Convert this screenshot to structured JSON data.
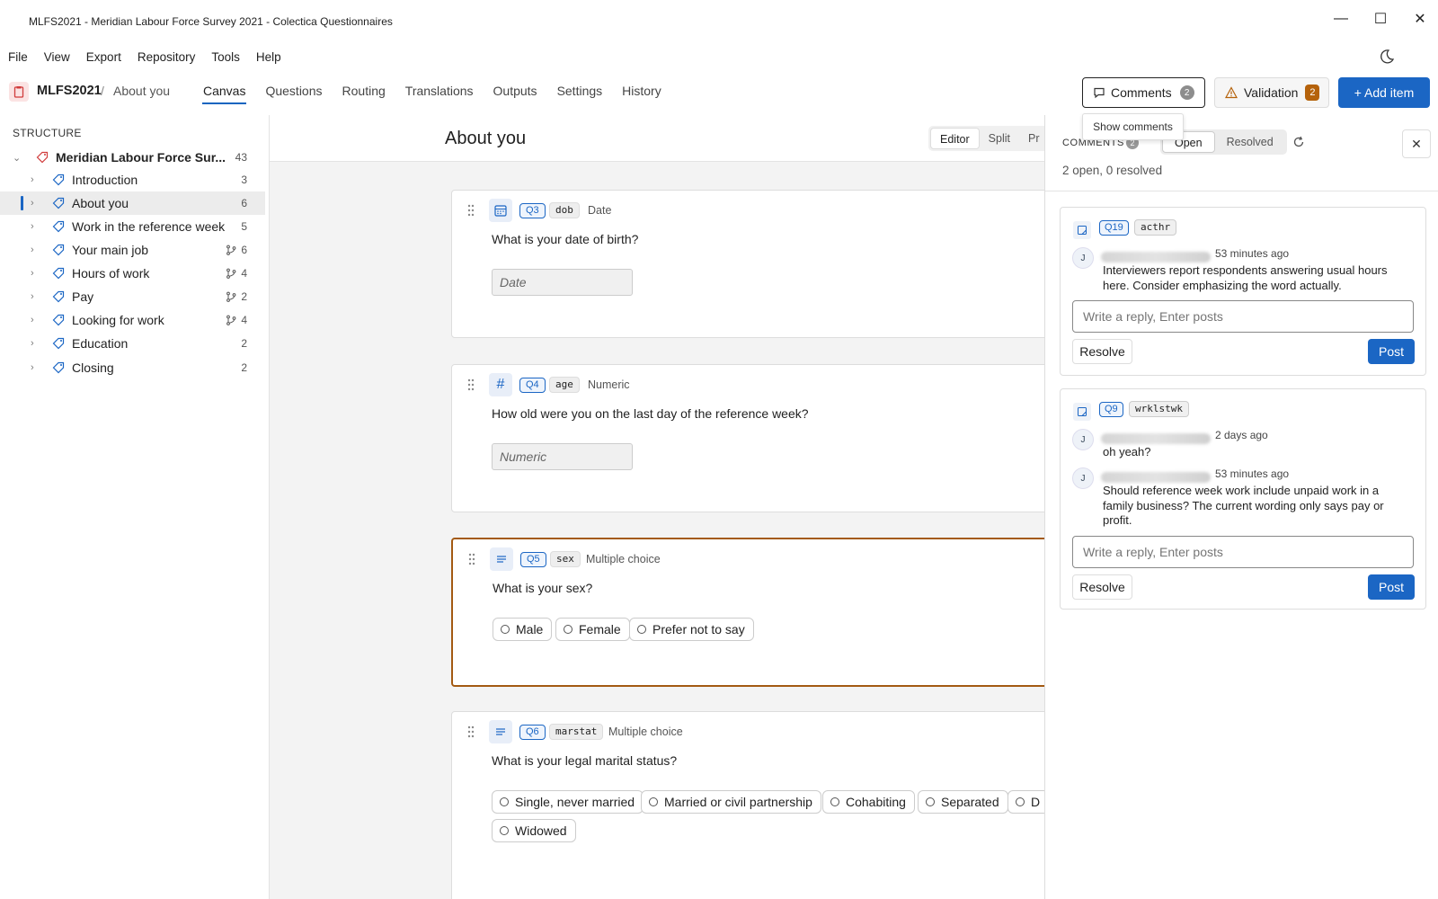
{
  "window": {
    "title": "MLFS2021 - Meridian Labour Force Survey 2021 - Colectica Questionnaires",
    "minimize": "—",
    "maximize": "☐",
    "close": "✕"
  },
  "menu": [
    "File",
    "View",
    "Export",
    "Repository",
    "Tools",
    "Help"
  ],
  "breadcrumb": {
    "root": "MLFS2021",
    "sep": "/",
    "current": "About you"
  },
  "tabs": [
    {
      "label": "Canvas",
      "active": true
    },
    {
      "label": "Questions"
    },
    {
      "label": "Routing"
    },
    {
      "label": "Translations"
    },
    {
      "label": "Outputs"
    },
    {
      "label": "Settings"
    },
    {
      "label": "History"
    }
  ],
  "toolbar": {
    "comments_label": "Comments",
    "comments_count": "2",
    "validation_label": "Validation",
    "validation_count": "2",
    "add_label": "+ Add item",
    "tooltip": "Show comments"
  },
  "sidebar": {
    "heading": "STRUCTURE",
    "root": {
      "label": "Meridian Labour Force Sur...",
      "count": "43"
    },
    "items": [
      {
        "label": "Introduction",
        "count": "3",
        "branch": false
      },
      {
        "label": "About you",
        "count": "6",
        "branch": false,
        "selected": true
      },
      {
        "label": "Work in the reference week",
        "count": "5",
        "branch": false
      },
      {
        "label": "Your main job",
        "count": "6",
        "branch": true
      },
      {
        "label": "Hours of work",
        "count": "4",
        "branch": true
      },
      {
        "label": "Pay",
        "count": "2",
        "branch": true
      },
      {
        "label": "Looking for work",
        "count": "4",
        "branch": true
      },
      {
        "label": "Education",
        "count": "2",
        "branch": false
      },
      {
        "label": "Closing",
        "count": "2",
        "branch": false
      }
    ]
  },
  "main": {
    "title": "About you",
    "views": [
      "Editor",
      "Split",
      "Pr"
    ],
    "questions": [
      {
        "num": "Q3",
        "var": "dob",
        "type": "Date",
        "text": "What is your date of birth?",
        "placeholder": "Date"
      },
      {
        "num": "Q4",
        "var": "age",
        "type": "Numeric",
        "text": "How old were you on the last day of the reference week?",
        "placeholder": "Numeric"
      },
      {
        "num": "Q5",
        "var": "sex",
        "type": "Multiple choice",
        "text": "What is your sex?",
        "choices": [
          "Male",
          "Female",
          "Prefer not to say"
        ]
      },
      {
        "num": "Q6",
        "var": "marstat",
        "type": "Multiple choice",
        "text": "What is your legal marital status?",
        "choices": [
          "Single, never married",
          "Married or civil partnership",
          "Cohabiting",
          "Separated",
          "D",
          "Widowed"
        ]
      }
    ]
  },
  "comments": {
    "heading": "COMMENTS",
    "count": "2",
    "filters": [
      "Open",
      "Resolved"
    ],
    "summary": "2 open, 0 resolved",
    "threads": [
      {
        "num": "Q19",
        "var": "acthr",
        "posts": [
          {
            "avatar": "J",
            "time": "53 minutes ago",
            "body": "Interviewers report respondents answering usual hours here. Consider emphasizing the word actually."
          }
        ],
        "reply_placeholder": "Write a reply, Enter posts",
        "resolve": "Resolve",
        "post": "Post"
      },
      {
        "num": "Q9",
        "var": "wrklstwk",
        "posts": [
          {
            "avatar": "J",
            "time": "2 days ago",
            "body": "oh yeah?"
          },
          {
            "avatar": "J",
            "time": "53 minutes ago",
            "body": "Should reference week work include unpaid work in a family business? The current wording only says pay or profit."
          }
        ],
        "reply_placeholder": "Write a reply, Enter posts",
        "resolve": "Resolve",
        "post": "Post"
      }
    ]
  },
  "colors": {
    "accent": "#1b66c4",
    "selected_border": "#a35a12",
    "warning_badge": "#b5620b"
  }
}
